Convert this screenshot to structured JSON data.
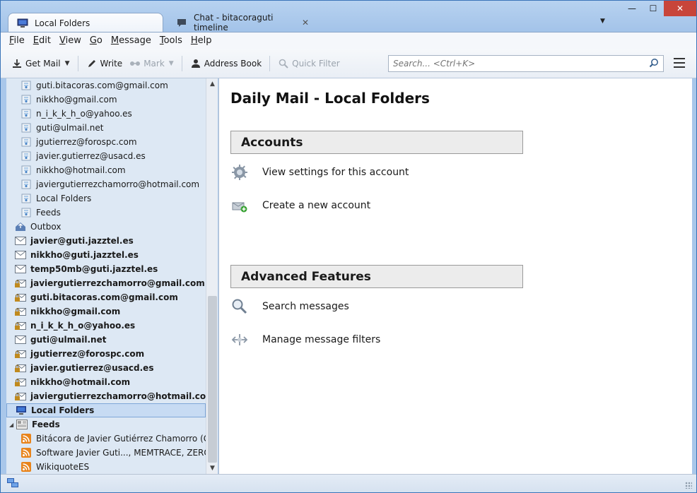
{
  "tabs": [
    {
      "label": "Local Folders",
      "icon": "computer-icon",
      "active": true
    },
    {
      "label": "Chat - bitacoraguti timeline",
      "icon": "chat-icon",
      "active": false
    }
  ],
  "window": {
    "minimize": "—",
    "maximize": "☐",
    "close": "✕"
  },
  "menu": [
    {
      "key": "F",
      "rest": "ile"
    },
    {
      "key": "E",
      "rest": "dit"
    },
    {
      "key": "V",
      "rest": "iew"
    },
    {
      "key": "G",
      "rest": "o"
    },
    {
      "key": "M",
      "rest": "essage"
    },
    {
      "key": "T",
      "rest": "ools"
    },
    {
      "key": "H",
      "rest": "elp"
    }
  ],
  "toolbar": {
    "get_mail": "Get Mail",
    "write": "Write",
    "mark": "Mark",
    "address_book": "Address Book",
    "quick_filter": "Quick Filter",
    "search_placeholder": "Search... <Ctrl+K>"
  },
  "folders": [
    {
      "label": "guti.bitacoras.com@gmail.com",
      "icon": "folder-icon",
      "level": 2,
      "bold": false
    },
    {
      "label": "nikkho@gmail.com",
      "icon": "folder-icon",
      "level": 2,
      "bold": false
    },
    {
      "label": "n_i_k_k_h_o@yahoo.es",
      "icon": "folder-icon",
      "level": 2,
      "bold": false
    },
    {
      "label": "guti@ulmail.net",
      "icon": "folder-icon",
      "level": 2,
      "bold": false
    },
    {
      "label": "jgutierrez@forospc.com",
      "icon": "folder-icon",
      "level": 2,
      "bold": false
    },
    {
      "label": "javier.gutierrez@usacd.es",
      "icon": "folder-icon",
      "level": 2,
      "bold": false
    },
    {
      "label": "nikkho@hotmail.com",
      "icon": "folder-icon",
      "level": 2,
      "bold": false
    },
    {
      "label": "javiergutierrezchamorro@hotmail.com",
      "icon": "folder-icon",
      "level": 2,
      "bold": false
    },
    {
      "label": "Local Folders",
      "icon": "folder-icon",
      "level": 2,
      "bold": false
    },
    {
      "label": "Feeds",
      "icon": "folder-icon",
      "level": 2,
      "bold": false
    },
    {
      "label": "Outbox",
      "icon": "outbox-icon",
      "level": 1,
      "bold": false
    },
    {
      "label": "javier@guti.jazztel.es",
      "icon": "envelope-icon",
      "level": 1,
      "bold": true
    },
    {
      "label": "nikkho@guti.jazztel.es",
      "icon": "envelope-icon",
      "level": 1,
      "bold": true
    },
    {
      "label": "temp50mb@guti.jazztel.es",
      "icon": "envelope-icon",
      "level": 1,
      "bold": true
    },
    {
      "label": "javiergutierrezchamorro@gmail.com",
      "icon": "secure-envelope-icon",
      "level": 1,
      "bold": true
    },
    {
      "label": "guti.bitacoras.com@gmail.com",
      "icon": "secure-envelope-icon",
      "level": 1,
      "bold": true
    },
    {
      "label": "nikkho@gmail.com",
      "icon": "secure-envelope-icon",
      "level": 1,
      "bold": true
    },
    {
      "label": "n_i_k_k_h_o@yahoo.es",
      "icon": "secure-envelope-icon",
      "level": 1,
      "bold": true
    },
    {
      "label": "guti@ulmail.net",
      "icon": "envelope-icon",
      "level": 1,
      "bold": true
    },
    {
      "label": "jgutierrez@forospc.com",
      "icon": "secure-envelope-icon",
      "level": 1,
      "bold": true
    },
    {
      "label": "javier.gutierrez@usacd.es",
      "icon": "secure-envelope-icon",
      "level": 1,
      "bold": true
    },
    {
      "label": "nikkho@hotmail.com",
      "icon": "secure-envelope-icon",
      "level": 1,
      "bold": true
    },
    {
      "label": "javiergutierrezchamorro@hotmail.com",
      "icon": "secure-envelope-icon",
      "level": 1,
      "bold": true
    },
    {
      "label": "Local Folders",
      "icon": "computer-icon",
      "level": 1,
      "bold": true,
      "selected": true
    },
    {
      "label": "Feeds",
      "icon": "newspaper-icon",
      "level": 1,
      "bold": true,
      "expanded": true
    },
    {
      "label": "Bitácora de Javier Gutiérrez Chamorro (Guti)",
      "icon": "rss-icon",
      "level": 2,
      "bold": false
    },
    {
      "label": "Software Javier Guti..., MEMTRACE, ZEROFILL",
      "icon": "rss-icon",
      "level": 2,
      "bold": false
    },
    {
      "label": "WikiquoteES",
      "icon": "rss-icon",
      "level": 2,
      "bold": false
    }
  ],
  "main": {
    "title": "Daily Mail - Local Folders",
    "accounts_header": "Accounts",
    "view_settings": "View settings for this account",
    "create_account": "Create a new account",
    "advanced_header": "Advanced Features",
    "search_messages": "Search messages",
    "manage_filters": "Manage message filters"
  },
  "colors": {
    "accent": "#3a74b8",
    "selection": "#c7dbf3",
    "close": "#c8453a"
  }
}
